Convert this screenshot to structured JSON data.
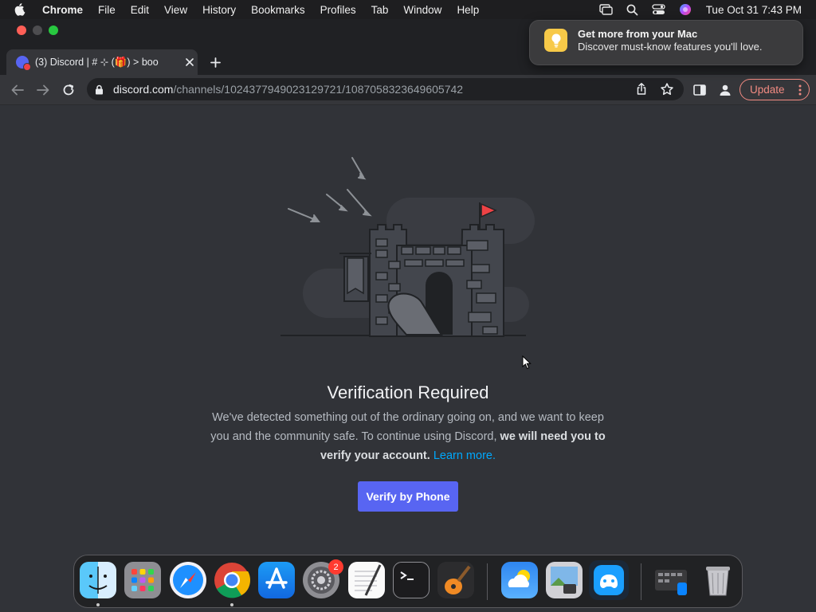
{
  "menubar": {
    "app_name": "Chrome",
    "items": [
      "File",
      "Edit",
      "View",
      "History",
      "Bookmarks",
      "Profiles",
      "Tab",
      "Window",
      "Help"
    ],
    "clock": "Tue Oct 31  7:43 PM",
    "status_icons": [
      "screen-mirroring-icon",
      "spotlight-search-icon",
      "control-center-icon",
      "siri-icon"
    ]
  },
  "browser": {
    "tab": {
      "title": "(3) Discord | # ⊹ (🎁) > boo",
      "badge_count": "3"
    },
    "address": {
      "host": "discord.com",
      "path": "/channels/1024377949023129721/1087058323649605742"
    },
    "update_label": "Update"
  },
  "notification": {
    "title": "Get more from your Mac",
    "body": "Discover must-know features you'll love.",
    "icon": "lightbulb-icon"
  },
  "page": {
    "title": "Verification Required",
    "description_part1": "We've detected something out of the ordinary going on, and we want to keep you and the community safe. To continue using Discord, ",
    "description_bold": "we will need you to verify your account.",
    "learn_more": "Learn more.",
    "verify_button": "Verify by Phone"
  },
  "dock": {
    "apps": [
      "Finder",
      "Launchpad",
      "Safari",
      "Google Chrome",
      "App Store",
      "System Settings",
      "TextEdit",
      "Terminal",
      "GarageBand",
      "Weather",
      "Preview",
      "Steam Link",
      "Mission Control",
      "Trash"
    ],
    "settings_badge": "2"
  },
  "colors": {
    "page_bg": "#313338",
    "blurple": "#5865f2",
    "link": "#00a8fc",
    "update_accent": "#f28b82"
  }
}
